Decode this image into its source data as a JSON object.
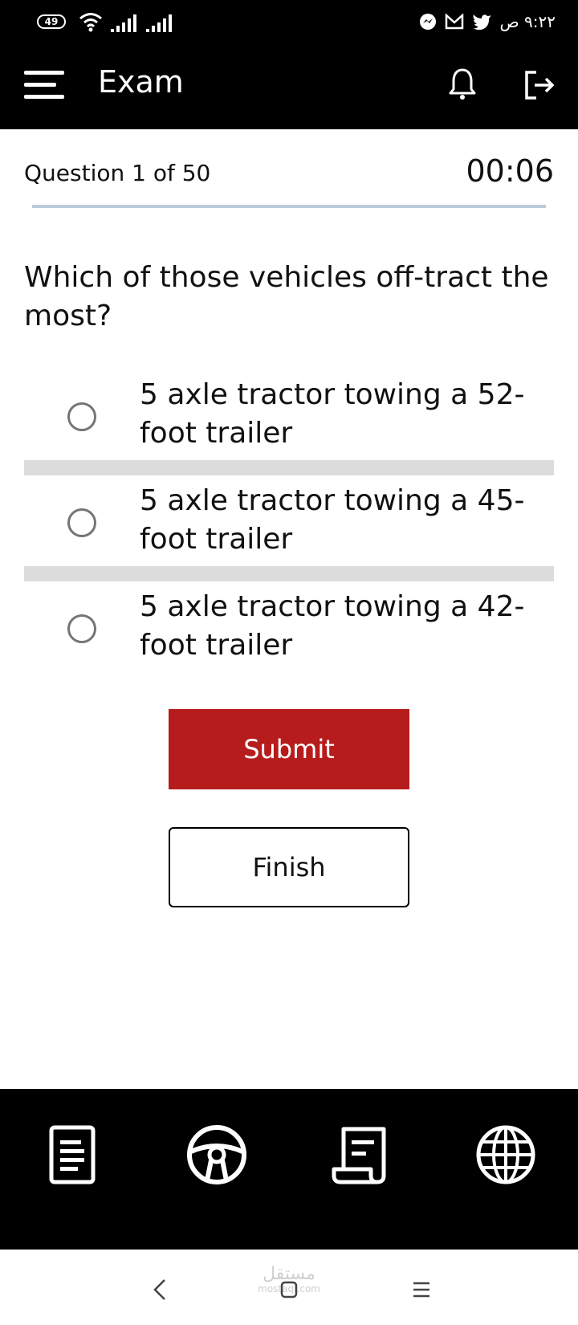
{
  "status_bar": {
    "battery": "49",
    "time": "٩:٢٢ ص"
  },
  "app_bar": {
    "title": "Exam"
  },
  "exam": {
    "counter": "Question 1 of 50",
    "timer": "00:06",
    "question": "Which of those vehicles off-tract the most?",
    "options": [
      {
        "label": "5 axle tractor towing a 52-foot trailer",
        "selected": false
      },
      {
        "label": "5 axle tractor towing a 45-foot trailer",
        "selected": false
      },
      {
        "label": "5 axle tractor towing a 42-foot trailer",
        "selected": false
      }
    ],
    "submit_label": "Submit",
    "finish_label": "Finish"
  },
  "bottom_nav": {
    "items": [
      "document-icon",
      "steering-wheel-icon",
      "script-icon",
      "globe-icon"
    ]
  },
  "watermark": {
    "arabic": "مستقل",
    "latin": "mostaql.com"
  },
  "colors": {
    "bar_background": "#000000",
    "submit_red": "#b71c1c",
    "separator_gray": "#dcdcdc",
    "progress_track": "#bccbdb"
  }
}
